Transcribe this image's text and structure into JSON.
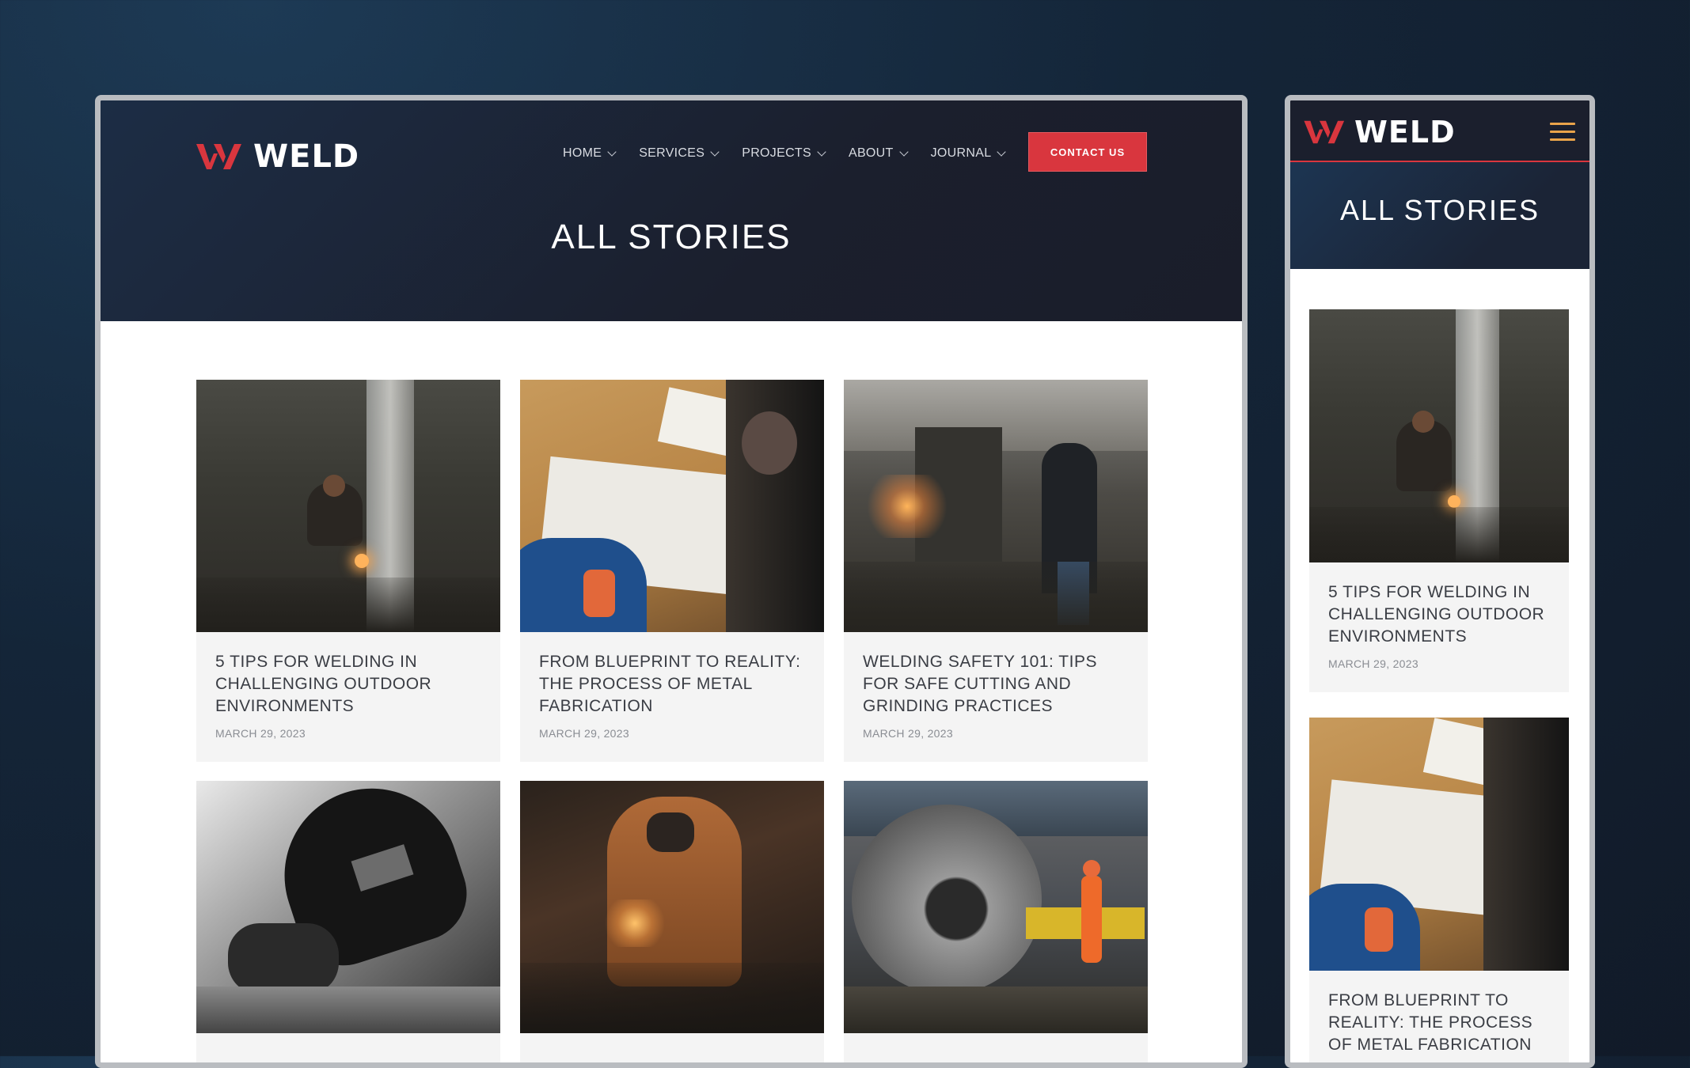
{
  "brand": {
    "name": "WELD",
    "accent": "#d9363e",
    "dark": "#1b1f2d"
  },
  "nav": {
    "items": [
      {
        "label": "HOME"
      },
      {
        "label": "SERVICES"
      },
      {
        "label": "PROJECTS"
      },
      {
        "label": "ABOUT"
      },
      {
        "label": "JOURNAL"
      }
    ],
    "cta": "CONTACT US"
  },
  "page_title": "ALL STORIES",
  "posts": [
    {
      "title": "5 TIPS FOR WELDING IN CHALLENGING OUTDOOR ENVIRONMENTS",
      "date": "MARCH 29, 2023"
    },
    {
      "title": "FROM BLUEPRINT TO REALITY: THE PROCESS OF METAL FABRICATION",
      "date": "MARCH 29, 2023"
    },
    {
      "title": "WELDING SAFETY 101: TIPS FOR SAFE CUTTING AND GRINDING PRACTICES",
      "date": "MARCH 29, 2023"
    },
    {
      "title": "",
      "date": ""
    },
    {
      "title": "",
      "date": ""
    },
    {
      "title": "",
      "date": ""
    }
  ],
  "mobile": {
    "posts": [
      {
        "title": "5 TIPS FOR WELDING IN CHALLENGING OUTDOOR ENVIRONMENTS",
        "date": "MARCH 29, 2023"
      },
      {
        "title": "FROM BLUEPRINT TO REALITY: THE PROCESS OF METAL FABRICATION",
        "date": ""
      }
    ]
  },
  "icons": {
    "menu": "hamburger-icon",
    "logo": "weld-logo-mark",
    "dropdown": "chevron-down-icon"
  }
}
